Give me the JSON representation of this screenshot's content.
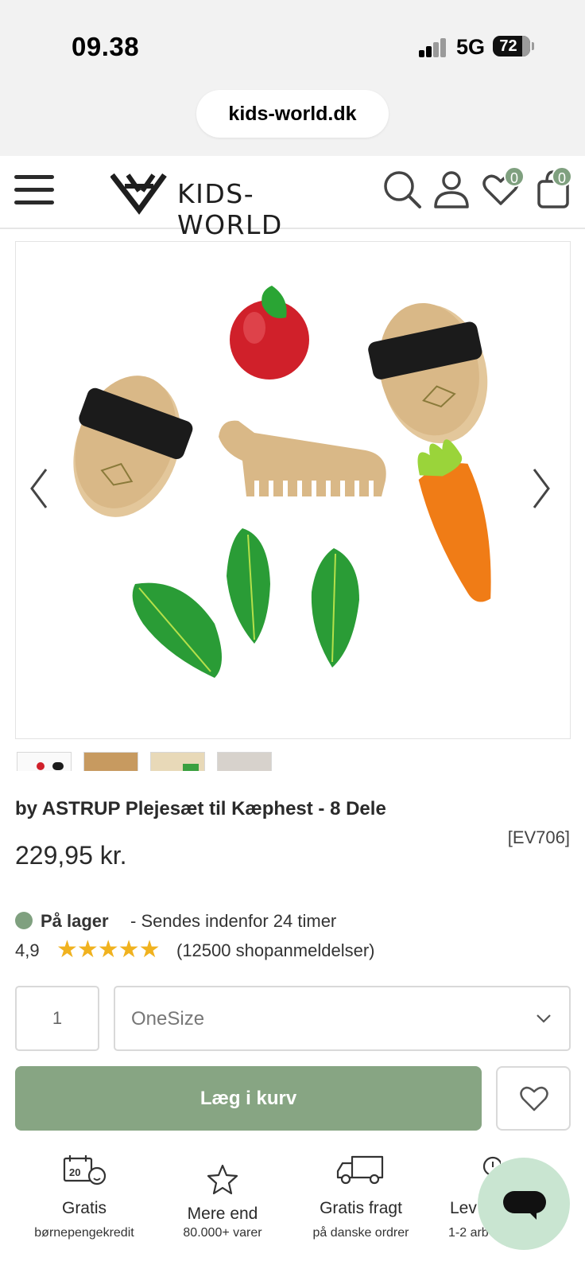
{
  "status_bar": {
    "time": "09.38",
    "network": "5G",
    "battery": "72"
  },
  "browser": {
    "url": "kids-world.dk"
  },
  "header": {
    "brand": "KIDS-WORLD",
    "wishlist_count": "0",
    "cart_count": "0"
  },
  "product": {
    "title": "by ASTRUP Plejesæt til Kæphest - 8 Dele",
    "sku": "[EV706]",
    "price": "229,95 kr.",
    "stock_label": "På lager",
    "stock_note": "- Sendes indenfor 24 timer",
    "rating_value": "4,9",
    "stars": "★★★★★",
    "rating_count": "(12500 shopanmeldelser)",
    "quantity": "1",
    "size": "OneSize",
    "add_to_cart": "Læg i kurv"
  },
  "usps": [
    {
      "title": "Gratis",
      "subtitle": "børnepengekredit",
      "icon": "calendar-baby-icon"
    },
    {
      "title": "Mere end",
      "subtitle": "80.000+ varer",
      "icon": "star-icon"
    },
    {
      "title": "Gratis fragt",
      "subtitle": "på danske ordrer",
      "icon": "truck-icon"
    },
    {
      "title": "Lev",
      "subtitle": "1-2 arb",
      "icon": "clock-icon"
    }
  ],
  "colors": {
    "accent_green": "#87a583",
    "badge_green": "#7fa07f",
    "star_gold": "#f0b21f",
    "chat_bg": "#c9e5d1"
  }
}
